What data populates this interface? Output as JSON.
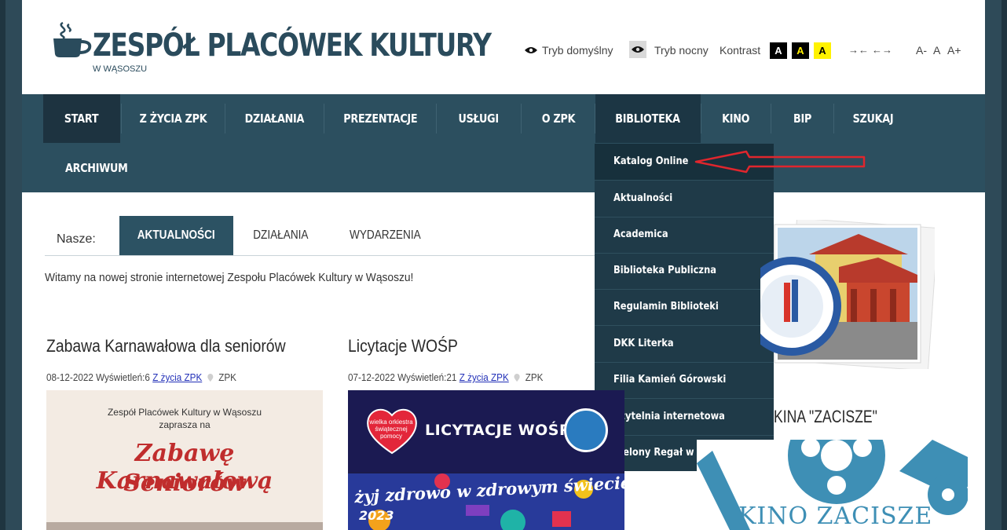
{
  "colors": {
    "frame": "#2e4a58",
    "nav_bg": "#2c4f5f",
    "dropdown_bg": "#1f3a48",
    "accent_tab": "#2c5263",
    "link": "#2230b8",
    "annotation_arrow": "#e0262d"
  },
  "header": {
    "logo_icon": "coffee-cup-icon",
    "title": "ZESPÓŁ PLACÓWEK KULTURY",
    "subtitle": "W WĄSOSZU",
    "tools": {
      "mode_default": "Tryb domyślny",
      "mode_night": "Tryb nocny",
      "contrast_label": "Kontrast",
      "contrast_options": [
        "A",
        "A",
        "A"
      ],
      "spacing_narrow": "→←",
      "spacing_wide": "←→",
      "font_smaller": "A-",
      "font_normal": "A",
      "font_larger": "A+"
    }
  },
  "nav": {
    "items": [
      "START",
      "Z ŻYCIA ZPK",
      "DZIAŁANIA",
      "PREZENTACJE",
      "USŁUGI",
      "O ZPK",
      "BIBLIOTEKA",
      "KINO",
      "BIP",
      "SZUKAJ",
      "ARCHIWUM"
    ],
    "active": "START",
    "open": "BIBLIOTEKA"
  },
  "dropdown": {
    "items": [
      "Katalog Online",
      "Aktualności",
      "Academica",
      "Biblioteka Publiczna",
      "Regulamin Biblioteki",
      "DKK Literka",
      "Filia Kamień Górowski",
      "Czytelnia internetowa",
      "Zielony Regał w bibliotece"
    ],
    "highlighted": "Katalog Online"
  },
  "tabs": {
    "label": "Nasze:",
    "items": [
      "AKTUALNOŚCI",
      "DZIAŁANIA",
      "WYDARZENIA"
    ],
    "active": "AKTUALNOŚCI"
  },
  "welcome": "Witamy na nowej stronie internetowej Zespołu Placówek Kultury w Wąsoszu!",
  "posts": [
    {
      "title": "Zabawa Karnawałowa dla seniorów",
      "date": "08-12-2022",
      "views": "Wyświetleń:6",
      "category": "Z życia ZPK",
      "location": "ZPK",
      "image": {
        "line1": "Zespół Placówek Kultury w Wąsoszu",
        "line2": "zaprasza na",
        "line3": "Zabawę Karnawałową",
        "line4": "Seniorów"
      }
    },
    {
      "title": "Licytacje WOŚP",
      "date": "07-12-2022",
      "views": "Wyświetleń:21",
      "category": "Z życia ZPK",
      "location": "ZPK",
      "image": {
        "logo_text": "wielka orkiestra świątecznej pomocy",
        "headline": "LICYTACJE WOŚP",
        "slogan": "żyj zdrowo w zdrowym świecie",
        "year": "2023"
      }
    }
  ],
  "sidebar": {
    "kino_heading": "KINA \"ZACISZE\"",
    "kino_banner": "KINO ZACISZE"
  }
}
